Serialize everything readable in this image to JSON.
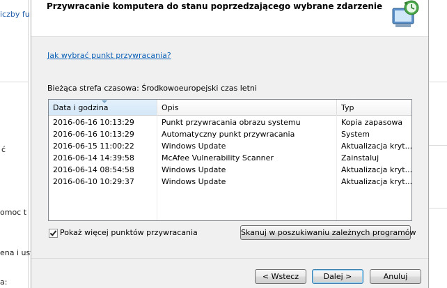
{
  "background_window": {
    "texts": [
      "iczby fu",
      "ć",
      "omoc t",
      "ena i ust",
      "a:"
    ]
  },
  "dialog": {
    "title": "Przywracanie komputera do stanu poprzedzającego wybrane zdarzenie",
    "help_link": "Jak wybrać punkt przywracania?",
    "timezone_label": "Bieżąca strefa czasowa: Środkowoeuropejski czas letni",
    "table": {
      "columns": [
        "Data i godzina",
        "Opis",
        "Typ"
      ],
      "rows": [
        {
          "date": "2016-06-16 10:13:29",
          "desc": "Punkt przywracania obrazu systemu",
          "type": "Kopia zapasowa"
        },
        {
          "date": "2016-06-16 10:13:29",
          "desc": "Automatyczny punkt przywracania",
          "type": "System"
        },
        {
          "date": "2016-06-15 11:00:22",
          "desc": "Windows Update",
          "type": "Aktualizacja kryt..."
        },
        {
          "date": "2016-06-14 14:39:58",
          "desc": "McAfee Vulnerability Scanner",
          "type": "Zainstaluj"
        },
        {
          "date": "2016-06-14 08:54:58",
          "desc": "Windows Update",
          "type": "Aktualizacja kryt..."
        },
        {
          "date": "2016-06-10 10:29:37",
          "desc": "Windows Update",
          "type": "Aktualizacja kryt..."
        }
      ]
    },
    "show_more_checkbox": {
      "label": "Pokaż więcej punktów przywracania",
      "checked": true
    },
    "buttons": {
      "scan": "Skanuj w poszukiwaniu zależnych programów",
      "back": "< Wstecz",
      "next": "Dalej >",
      "cancel": "Anuluj"
    },
    "icons": {
      "header": "system-restore-icon"
    }
  },
  "colors": {
    "link": "#0b5fb6",
    "dialog_bg": "#f0f0f0",
    "selected_header": "#d4e8f8"
  }
}
